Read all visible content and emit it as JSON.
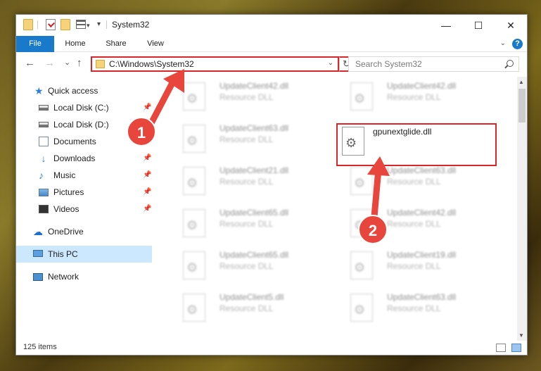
{
  "window": {
    "title": "System32",
    "controls": {
      "minimize": "—",
      "maximize": "☐",
      "close": "✕"
    }
  },
  "ribbon": {
    "tabs": [
      "File",
      "Home",
      "Share",
      "View"
    ],
    "help": "?"
  },
  "nav": {
    "back": "←",
    "forward": "→",
    "recent": "⌄",
    "up": "↑",
    "address": "C:\\Windows\\System32",
    "refresh": "↻"
  },
  "search": {
    "placeholder": "Search System32"
  },
  "sidebar": {
    "items": [
      {
        "label": "Quick access",
        "icon": "star-icon"
      },
      {
        "label": "Local Disk (C:)",
        "icon": "disk-icon"
      },
      {
        "label": "Local Disk (D:)",
        "icon": "disk-icon"
      },
      {
        "label": "Documents",
        "icon": "documents-icon"
      },
      {
        "label": "Downloads",
        "icon": "download-icon"
      },
      {
        "label": "Music",
        "icon": "music-icon"
      },
      {
        "label": "Pictures",
        "icon": "pictures-icon"
      },
      {
        "label": "Videos",
        "icon": "videos-icon"
      },
      {
        "label": "OneDrive",
        "icon": "cloud-icon"
      },
      {
        "label": "This PC",
        "icon": "pc-icon"
      },
      {
        "label": "Network",
        "icon": "network-icon"
      }
    ]
  },
  "files": [
    {
      "name": "UpdateClient42.dll",
      "type": "Resource DLL"
    },
    {
      "name": "UpdateClient42.dll",
      "type": "Resource DLL"
    },
    {
      "name": "UpdateClient63.dll",
      "type": "Resource DLL"
    },
    {
      "name": "UpdateClient21.dll",
      "type": "Resource DLL"
    },
    {
      "name": "UpdateClient63.dll",
      "type": "Resource DLL"
    },
    {
      "name": "UpdateClient65.dll",
      "type": "Resource DLL"
    },
    {
      "name": "UpdateClient42.dll",
      "type": "Resource DLL"
    },
    {
      "name": "UpdateClient65.dll",
      "type": "Resource DLL"
    },
    {
      "name": "UpdateClient19.dll",
      "type": "Resource DLL"
    },
    {
      "name": "UpdateClient5.dll",
      "type": "Resource DLL"
    },
    {
      "name": "UpdateClient63.dll",
      "type": "Resource DLL"
    }
  ],
  "highlighted_file": {
    "name": "gpunextglide.dll"
  },
  "status": {
    "item_count": "125 items"
  },
  "annotations": {
    "marker1": "1",
    "marker2": "2",
    "highlight_color": "#d9262b",
    "marker_color": "#e8453c"
  }
}
